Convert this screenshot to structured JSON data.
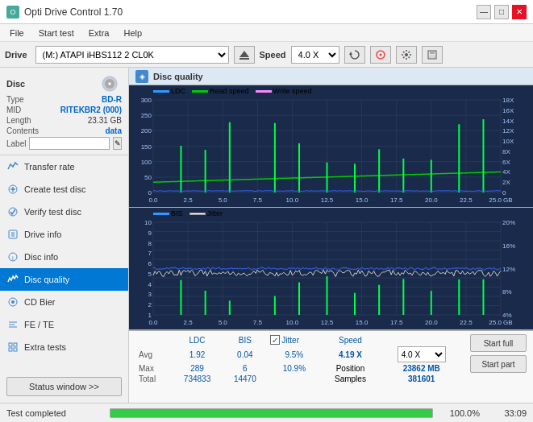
{
  "app": {
    "title": "Opti Drive Control 1.70",
    "icon": "O"
  },
  "titlebar": {
    "minimize": "—",
    "maximize": "□",
    "close": "✕"
  },
  "menubar": {
    "items": [
      "File",
      "Start test",
      "Extra",
      "Help"
    ]
  },
  "drivebar": {
    "drive_label": "Drive",
    "drive_value": "(M:) ATAPI iHBS112  2 CL0K",
    "speed_label": "Speed",
    "speed_value": "4.0 X"
  },
  "disc": {
    "section_label": "Disc",
    "type_label": "Type",
    "type_value": "BD-R",
    "mid_label": "MID",
    "mid_value": "RITEKBR2 (000)",
    "length_label": "Length",
    "length_value": "23.31 GB",
    "contents_label": "Contents",
    "contents_value": "data",
    "label_label": "Label"
  },
  "nav": {
    "items": [
      {
        "id": "transfer-rate",
        "label": "Transfer rate",
        "active": false
      },
      {
        "id": "create-test-disc",
        "label": "Create test disc",
        "active": false
      },
      {
        "id": "verify-test-disc",
        "label": "Verify test disc",
        "active": false
      },
      {
        "id": "drive-info",
        "label": "Drive info",
        "active": false
      },
      {
        "id": "disc-info",
        "label": "Disc info",
        "active": false
      },
      {
        "id": "disc-quality",
        "label": "Disc quality",
        "active": true
      },
      {
        "id": "cd-bier",
        "label": "CD Bier",
        "active": false
      },
      {
        "id": "fe-te",
        "label": "FE / TE",
        "active": false
      },
      {
        "id": "extra-tests",
        "label": "Extra tests",
        "active": false
      }
    ],
    "status_window_label": "Status window >>"
  },
  "quality": {
    "title": "Disc quality",
    "legend": {
      "ldc_label": "LDC",
      "ldc_color": "#0000ff",
      "read_label": "Read speed",
      "read_color": "#00cc00",
      "write_label": "Write speed",
      "write_color": "#ff00ff",
      "bis_label": "BIS",
      "bis_color": "#0000ff",
      "jitter_label": "Jitter",
      "jitter_color": "#ffffff"
    }
  },
  "stats": {
    "headers": [
      "LDC",
      "BIS",
      "",
      "Jitter",
      "Speed"
    ],
    "avg_label": "Avg",
    "max_label": "Max",
    "total_label": "Total",
    "ldc_avg": "1.92",
    "ldc_max": "289",
    "ldc_total": "734833",
    "bis_avg": "0.04",
    "bis_max": "6",
    "bis_total": "14470",
    "jitter_avg": "9.5%",
    "jitter_max": "10.9%",
    "jitter_total": "",
    "speed_label": "Speed",
    "speed_value": "4.19 X",
    "position_label": "Position",
    "position_value": "23862 MB",
    "samples_label": "Samples",
    "samples_value": "381601",
    "speed_dropdown": "4.0 X",
    "jitter_checked": true,
    "jitter_check_label": "Jitter"
  },
  "buttons": {
    "start_full": "Start full",
    "start_part": "Start part"
  },
  "statusbar": {
    "status_text": "Test completed",
    "progress": 100,
    "progress_text": "100.0%",
    "time_text": "33:09"
  }
}
